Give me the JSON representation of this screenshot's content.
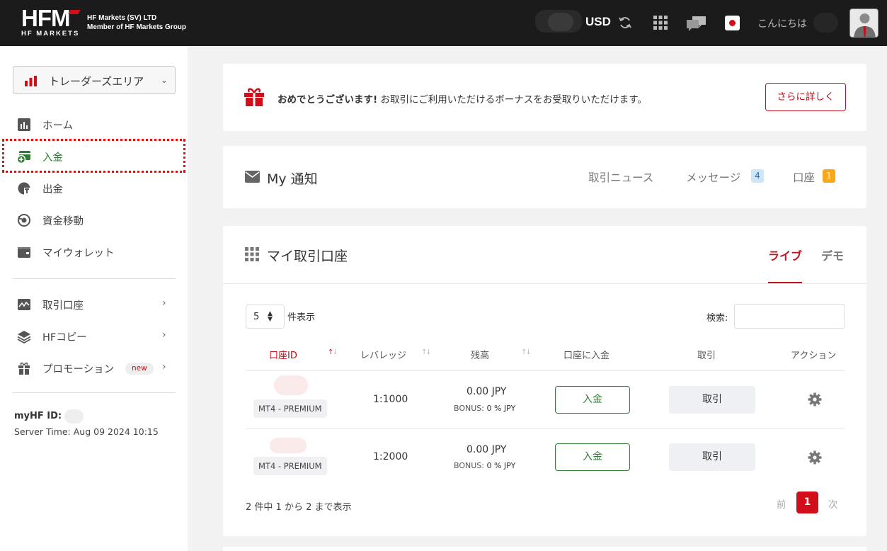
{
  "header": {
    "brand_big": "HFM",
    "brand_small": "HF MARKETS",
    "company_line1": "HF Markets (SV) LTD",
    "company_line2": "Member of HF Markets Group",
    "currency": "USD",
    "greeting": "こんにちは"
  },
  "sidebar": {
    "area_select": "トレーダーズエリア",
    "items": [
      {
        "label": "ホーム",
        "icon": "chart-icon"
      },
      {
        "label": "入金",
        "icon": "deposit-icon"
      },
      {
        "label": "出金",
        "icon": "withdraw-icon"
      },
      {
        "label": "資金移動",
        "icon": "transfer-icon"
      },
      {
        "label": "マイウォレット",
        "icon": "wallet-icon"
      },
      {
        "label": "取引口座",
        "icon": "trading-accounts-icon"
      },
      {
        "label": "HFコピー",
        "icon": "layers-icon"
      },
      {
        "label": "プロモーション",
        "icon": "gift-icon",
        "badge": "new"
      }
    ],
    "myhf_label": "myHF ID:",
    "server_time": "Server Time: Aug 09 2024 10:15"
  },
  "promo": {
    "bold": "おめでとうございます!",
    "text": " お取引にご利用いただけるボーナスをお受取りいただけます。",
    "button": "さらに詳しく"
  },
  "notifications": {
    "title": "My 通知",
    "tabs": [
      {
        "label": "取引ニュース"
      },
      {
        "label": "メッセージ",
        "count": "4"
      },
      {
        "label": "口座",
        "count": "1"
      }
    ]
  },
  "accounts": {
    "title": "マイ取引口座",
    "tab_live": "ライブ",
    "tab_demo": "デモ",
    "length_value": "5",
    "length_label": "件表示",
    "search_label": "検索:",
    "columns": [
      "口座ID",
      "レバレッジ",
      "残高",
      "口座に入金",
      "取引",
      "アクション"
    ],
    "rows": [
      {
        "type": "MT4 - PREMIUM",
        "leverage": "1:1000",
        "balance": "0.00 JPY",
        "bonus_label": "BONUS:",
        "bonus_value": "0 % JPY",
        "deposit": "入金",
        "trade": "取引"
      },
      {
        "type": "MT4 - PREMIUM",
        "leverage": "1:2000",
        "balance": "0.00 JPY",
        "bonus_label": "BONUS:",
        "bonus_value": "0 % JPY",
        "deposit": "入金",
        "trade": "取引"
      }
    ],
    "summary": "2 件中 1 から 2 まで表示",
    "pager": {
      "prev": "前",
      "current": "1",
      "next": "次"
    }
  },
  "colors": {
    "brand_red": "#d10e1a",
    "deposit_green": "#2e7d32",
    "topbar": "#1b1b1b"
  }
}
